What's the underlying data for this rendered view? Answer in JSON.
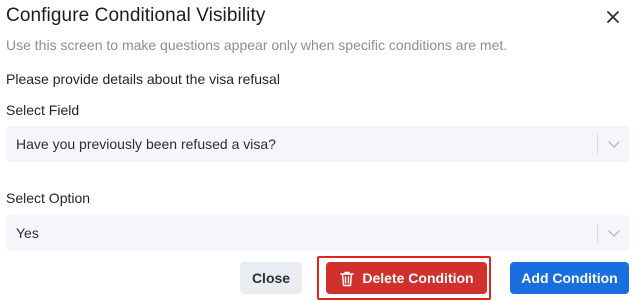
{
  "dialog": {
    "title": "Configure Conditional Visibility",
    "subtitle": "Use this screen to make questions appear only when specific conditions are met.",
    "context_label": "Please provide details about the visa refusal",
    "close_icon": "close-icon"
  },
  "fields": [
    {
      "label": "Select Field",
      "value": "Have you previously been refused a visa?"
    },
    {
      "label": "Select Option",
      "value": "Yes"
    }
  ],
  "buttons": {
    "close_label": "Close",
    "delete_label": "Delete Condition",
    "delete_icon": "trash-icon",
    "add_label": "Add Condition"
  },
  "colors": {
    "primary": "#1a6fe0",
    "danger": "#d0312d",
    "highlight": "#e1251b",
    "select_bg": "#f4f6fb"
  }
}
